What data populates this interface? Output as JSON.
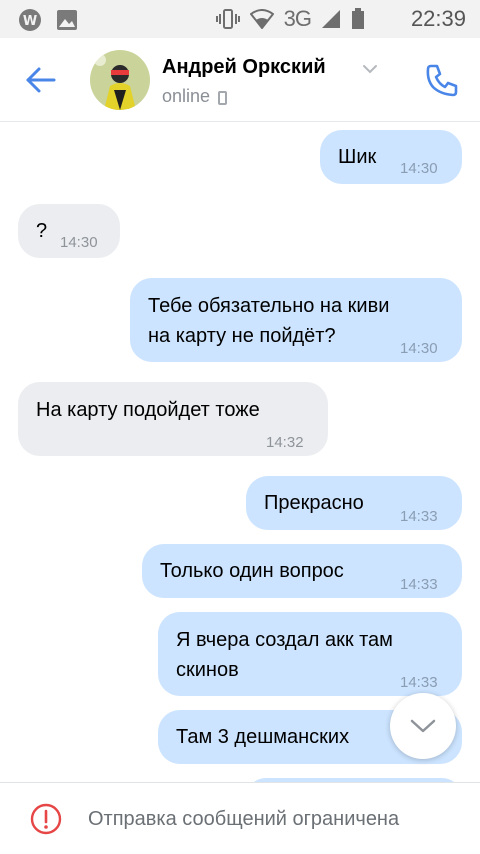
{
  "status_bar": {
    "network": "3G",
    "time": "22:39"
  },
  "header": {
    "peer_name": "Андрей Оркский",
    "status": "online"
  },
  "messages": [
    {
      "direction": "out",
      "lines": [
        "Шик"
      ],
      "time": "14:30"
    },
    {
      "direction": "in",
      "lines": [
        "?"
      ],
      "time": "14:30"
    },
    {
      "direction": "out",
      "lines": [
        "Тебе обязательно на киви",
        "на карту не пойдёт?"
      ],
      "time": "14:30"
    },
    {
      "direction": "in",
      "lines": [
        "На карту подойдет тоже"
      ],
      "time": "14:32"
    },
    {
      "direction": "out",
      "lines": [
        "Прекрасно"
      ],
      "time": "14:33"
    },
    {
      "direction": "out",
      "lines": [
        "Только один вопрос"
      ],
      "time": "14:33"
    },
    {
      "direction": "out",
      "lines": [
        "Я вчера создал акк там",
        "скинов"
      ],
      "time": "14:33"
    },
    {
      "direction": "out",
      "lines": [
        "Там 3 дешманских"
      ],
      "time": ""
    }
  ],
  "footer": {
    "notice": "Отправка сообщений ограничена"
  },
  "colors": {
    "accent": "#4a86e8",
    "outgoing_bubble": "#cce4ff",
    "incoming_bubble": "#ebedf0",
    "warning": "#e64646"
  }
}
